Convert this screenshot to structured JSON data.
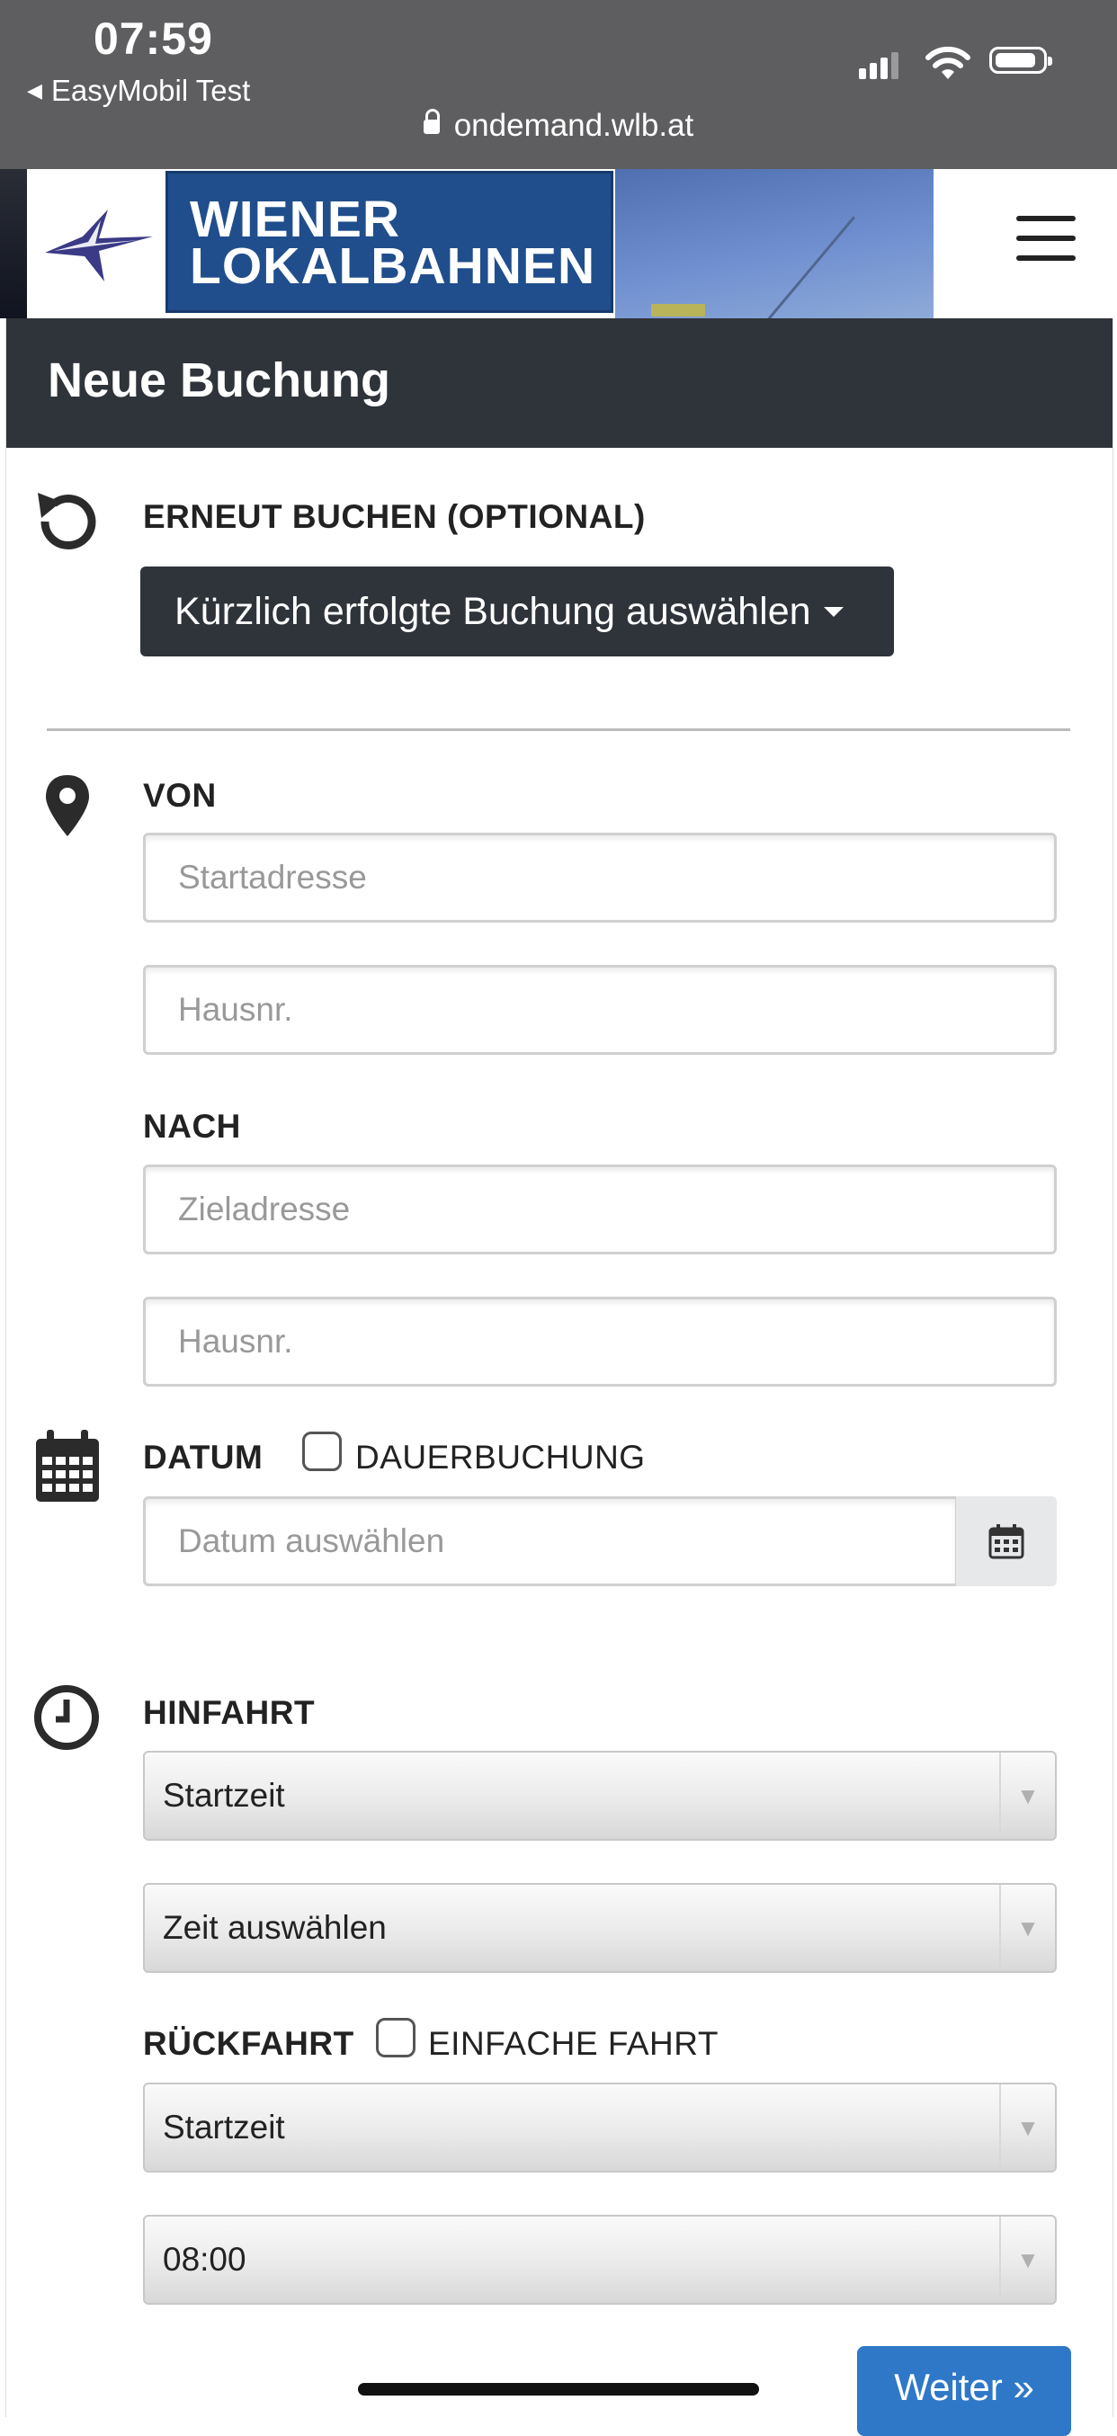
{
  "status_bar": {
    "time": "07:59",
    "back_app": "EasyMobil Test",
    "url": "ondemand.wlb.at"
  },
  "header": {
    "brand_line1": "WIENER",
    "brand_line2": "LOKALBAHNEN",
    "brand_color": "#204e8c"
  },
  "card": {
    "title": "Neue Buchung"
  },
  "rebook": {
    "label": "ERNEUT BUCHEN (OPTIONAL)",
    "button_label": "Kürzlich erfolgte Buchung auswählen",
    "icon": "history-icon"
  },
  "from": {
    "label": "VON",
    "address_placeholder": "Startadresse",
    "house_placeholder": "Hausnr.",
    "icon": "map-marker-icon"
  },
  "to": {
    "label": "NACH",
    "address_placeholder": "Zieladresse",
    "house_placeholder": "Hausnr."
  },
  "date": {
    "label": "DATUM",
    "recurring_label": "DAUERBUCHUNG",
    "placeholder": "Datum auswählen",
    "icon": "calendar-icon"
  },
  "outbound": {
    "label": "HINFAHRT",
    "mode_value": "Startzeit",
    "time_value": "Zeit auswählen",
    "icon": "clock-icon"
  },
  "return_trip": {
    "label": "RÜCKFAHRT",
    "oneway_label": "EINFACHE FAHRT",
    "mode_value": "Startzeit",
    "time_value": "08:00"
  },
  "footer": {
    "next_label": "Weiter »",
    "accent": "#2e78c7"
  },
  "colors": {
    "header_dark": "#2f333a",
    "status_bar": "#5e5e60"
  }
}
